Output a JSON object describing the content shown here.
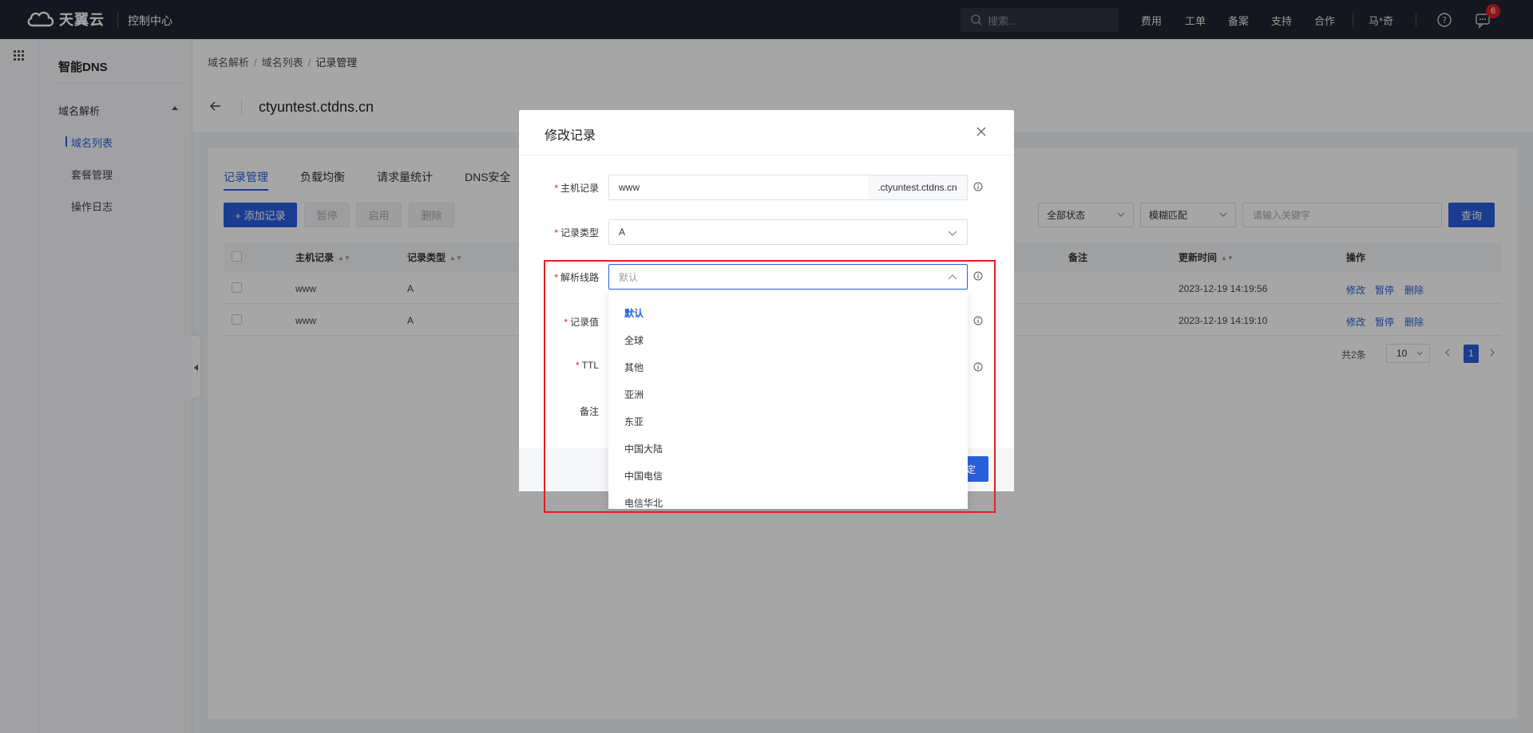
{
  "topbar": {
    "brand": "天翼云",
    "console": "控制中心",
    "search_placeholder": "搜索...",
    "nav": [
      "费用",
      "工单",
      "备案",
      "支持",
      "合作"
    ],
    "user": "马*奇",
    "badge": "6"
  },
  "sidebar": {
    "title": "智能DNS",
    "group": "域名解析",
    "items": [
      "域名列表",
      "套餐管理",
      "操作日志"
    ]
  },
  "breadcrumb": [
    "域名解析",
    "域名列表",
    "记录管理"
  ],
  "domain": "ctyuntest.ctdns.cn",
  "tabs": [
    "记录管理",
    "负载均衡",
    "请求量统计",
    "DNS安全"
  ],
  "toolbar": {
    "add": "+ 添加记录",
    "pause": "暂停",
    "enable": "启用",
    "delete": "删除",
    "status_filter": "全部状态",
    "match_filter": "模糊匹配",
    "keyword_placeholder": "请输入关键字",
    "query": "查询"
  },
  "table": {
    "headers": [
      "主机记录",
      "记录类型",
      "备注",
      "更新时间",
      "操作"
    ],
    "rows": [
      {
        "host": "www",
        "type": "A",
        "updated": "2023-12-19 14:19:56"
      },
      {
        "host": "www",
        "type": "A",
        "updated": "2023-12-19 14:19:10"
      }
    ],
    "actions": [
      "修改",
      "暂停",
      "删除"
    ]
  },
  "pager": {
    "total": "共2条",
    "size": "10",
    "current": "1"
  },
  "modal": {
    "title": "修改记录",
    "fields": {
      "host_label": "主机记录",
      "host_value": "www",
      "host_suffix": ".ctyuntest.ctdns.cn",
      "type_label": "记录类型",
      "type_value": "A",
      "line_label": "解析线路",
      "line_placeholder": "默认",
      "value_label": "记录值",
      "ttl_label": "TTL",
      "remark_label": "备注"
    },
    "ok_fragment": "定"
  },
  "dropdown": {
    "options": [
      "默认",
      "全球",
      "其他",
      "亚洲",
      "东亚",
      "中国大陆",
      "中国电信",
      "电信华北"
    ]
  },
  "colors": {
    "accent": "#2a5fdc",
    "highlight": "#e02020",
    "topbar": "#1f2430"
  }
}
